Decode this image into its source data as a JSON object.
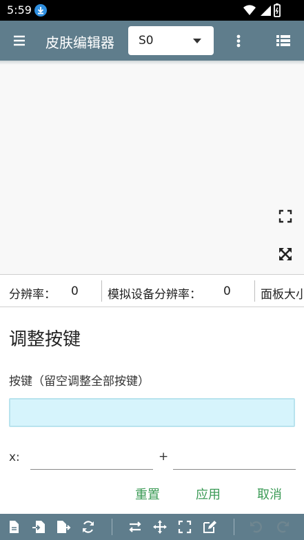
{
  "status_bar": {
    "time": "5:59"
  },
  "app_bar": {
    "title": "皮肤编辑器",
    "skin_select": {
      "value": "S0"
    }
  },
  "info_row": {
    "resolution_label": "分辨率：",
    "resolution_value": "0",
    "device_resolution_label": "模拟设备分辨率：",
    "device_resolution_value": "0",
    "panel_size_label": "面板大小"
  },
  "panel": {
    "title": "调整按键",
    "key_label": "按键（留空调整全部按键）",
    "key_input_value": "",
    "x_label": "x:",
    "plus_label": "+",
    "x_value": "",
    "y_value": ""
  },
  "actions": {
    "reset": "重置",
    "apply": "应用",
    "cancel": "取消"
  },
  "colors": {
    "app_bar": "#5f7d8c",
    "accent_text": "#3a9a55",
    "key_input_bg": "#d6f4fc"
  },
  "icons": {
    "menu": "hamburger-icon",
    "more": "more-vertical-icon",
    "list": "list-icon",
    "fit": "fit-screen-icon",
    "expand": "expand-arrows-icon",
    "toolbar": [
      "file-icon",
      "import-icon",
      "export-icon",
      "refresh-icon",
      "swap-icon",
      "move-icon",
      "fullscreen-icon",
      "edit-icon",
      "undo-icon",
      "redo-icon"
    ]
  }
}
